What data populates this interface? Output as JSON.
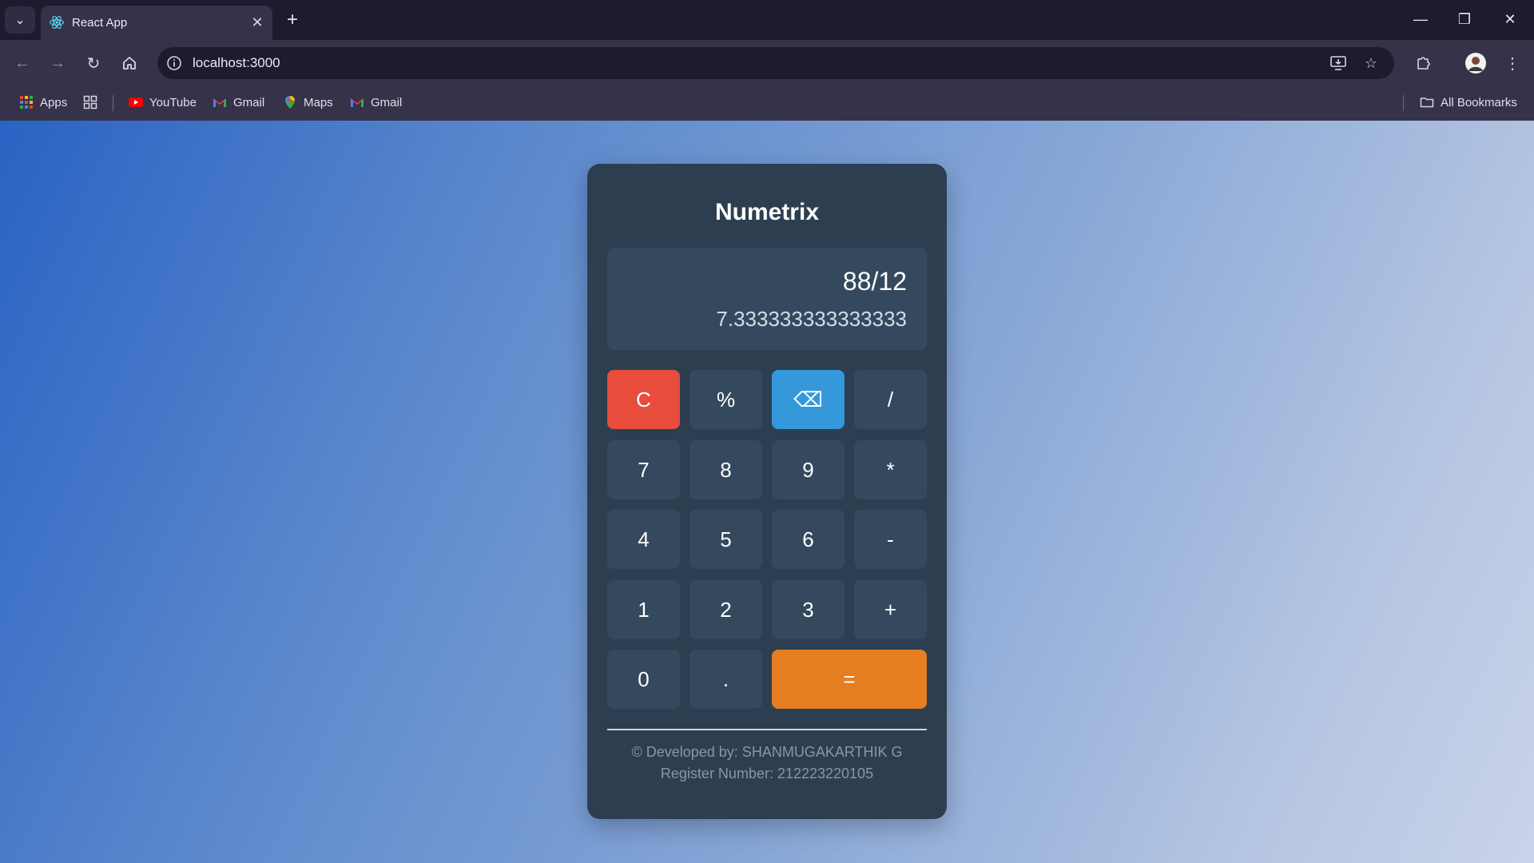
{
  "browser": {
    "tab_title": "React App",
    "url": "localhost:3000",
    "bookmarks": [
      "Apps",
      "YouTube",
      "Gmail",
      "Maps",
      "Gmail"
    ],
    "all_bookmarks": "All Bookmarks"
  },
  "calculator": {
    "title": "Numetrix",
    "expression": "88/12",
    "result": "7.333333333333333",
    "keys": [
      "C",
      "%",
      "⌫",
      "/",
      "7",
      "8",
      "9",
      "*",
      "4",
      "5",
      "6",
      "-",
      "1",
      "2",
      "3",
      "+",
      "0",
      ".",
      "="
    ],
    "footer_developer": "© Developed by: SHANMUGAKARTHIK G",
    "footer_register": "Register Number: 212223220105"
  },
  "colors": {
    "clear": "#e74c3c",
    "backspace": "#3498db",
    "equals": "#e67e22",
    "card": "#2d3e51"
  }
}
